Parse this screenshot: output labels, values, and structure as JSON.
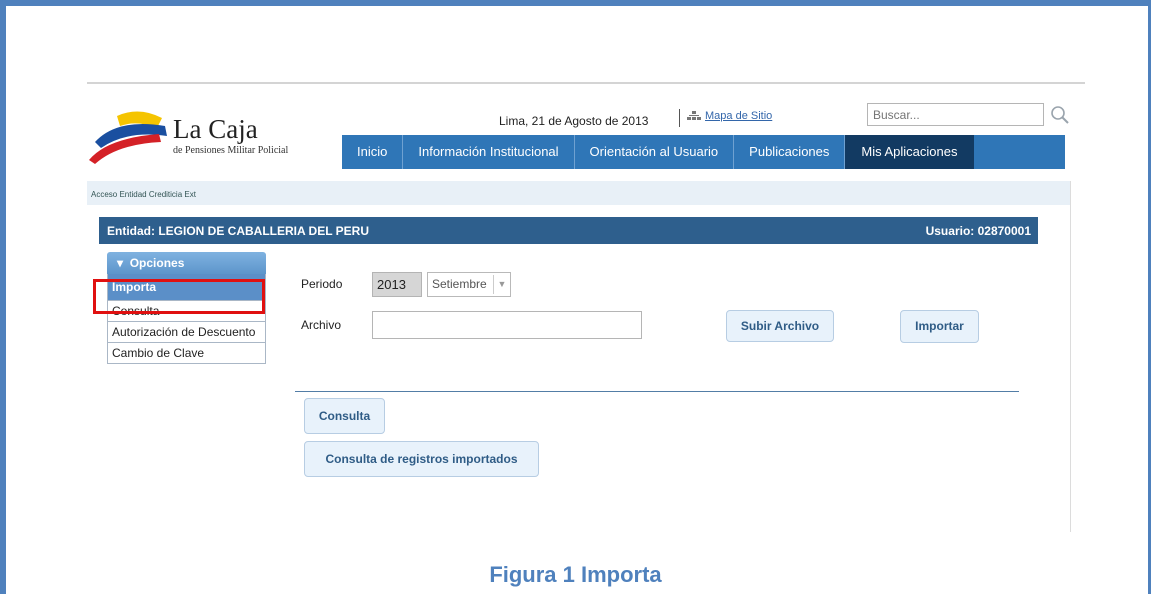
{
  "app": {
    "logo_name": "La Caja",
    "logo_subtitle": "de Pensiones Militar Policial",
    "brand_colors": {
      "yellow": "#f5c400",
      "blue": "#1a4fa0",
      "red": "#d42127"
    }
  },
  "header": {
    "date": "Lima, 21 de Agosto de 2013",
    "sitemap_icon": "sitemap-icon",
    "sitemap_label": "Mapa de Sitio",
    "search_placeholder": "Buscar...",
    "search_icon": "magnifier-icon"
  },
  "nav": {
    "items": [
      {
        "label": "Inicio"
      },
      {
        "label": "Información Institucional"
      },
      {
        "label": "Orientación al Usuario"
      },
      {
        "label": "Publicaciones"
      },
      {
        "label": "Mis Aplicaciones",
        "active": true
      }
    ]
  },
  "breadcrumb": "Acceso Entidad Crediticia Ext",
  "entity_bar": {
    "entity": "Entidad: LEGION DE CABALLERIA DEL PERU",
    "user": "Usuario: 02870001"
  },
  "side_menu": {
    "header": "Opciones",
    "header_icon": "caret-down-icon",
    "items": [
      {
        "label": "Importa",
        "selected": true
      },
      {
        "label": "Consulta"
      },
      {
        "label": "Autorización de Descuento"
      },
      {
        "label": "Cambio de Clave"
      }
    ]
  },
  "form": {
    "periodo_label": "Periodo",
    "year_value": "2013",
    "month_value": "Setiembre",
    "archivo_label": "Archivo",
    "subir_label": "Subir Archivo",
    "importar_label": "Importar",
    "consulta_label": "Consulta",
    "registros_label": "Consulta de registros importados"
  },
  "caption": "Figura 1 Importa",
  "colors": {
    "frame": "#4f81bd",
    "nav_bg": "#2f76b7",
    "nav_active": "#123a62",
    "entity_bar": "#2e5f8d",
    "highlight": "#e01010"
  }
}
